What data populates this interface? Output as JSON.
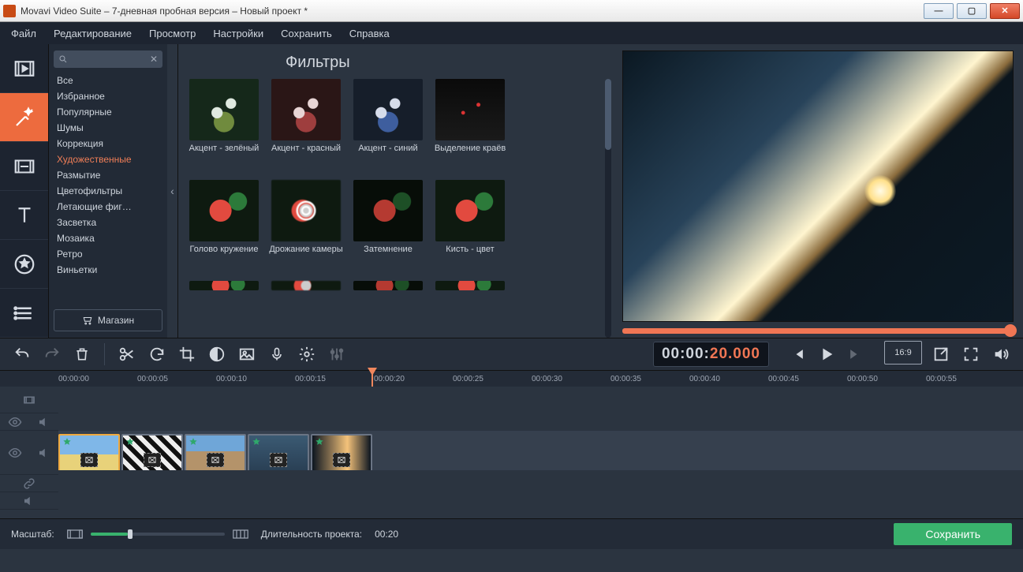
{
  "window": {
    "title": "Movavi Video Suite – 7-дневная пробная версия – Новый проект *"
  },
  "menu": [
    "Файл",
    "Редактирование",
    "Просмотр",
    "Настройки",
    "Сохранить",
    "Справка"
  ],
  "panel": {
    "heading": "Фильтры",
    "store_label": "Магазин",
    "categories": [
      "Все",
      "Избранное",
      "Популярные",
      "Шумы",
      "Коррекция",
      "Художественные",
      "Размытие",
      "Цветофильтры",
      "Летающие фиг…",
      "Засветка",
      "Мозаика",
      "Ретро",
      "Виньетки"
    ],
    "selected_category": "Художественные",
    "filters": [
      {
        "label": "Акцент - зелёный"
      },
      {
        "label": "Акцент - красный"
      },
      {
        "label": "Акцент - синий"
      },
      {
        "label": "Выделение краёв"
      },
      {
        "label": "Голово кружение"
      },
      {
        "label": "Дрожание камеры"
      },
      {
        "label": "Затемнение"
      },
      {
        "label": "Кисть - цвет"
      }
    ]
  },
  "timecode": {
    "gray": "00:00:",
    "orange": "20.000"
  },
  "aspect": "16:9",
  "ruler": [
    "00:00:00",
    "00:00:05",
    "00:00:10",
    "00:00:15",
    "00:00:20",
    "00:00:25",
    "00:00:30",
    "00:00:35",
    "00:00:40",
    "00:00:45",
    "00:00:50",
    "00:00:55"
  ],
  "bottom": {
    "zoom_label": "Масштаб:",
    "duration_label": "Длительность проекта:",
    "duration_value": "00:20",
    "save_label": "Сохранить"
  }
}
